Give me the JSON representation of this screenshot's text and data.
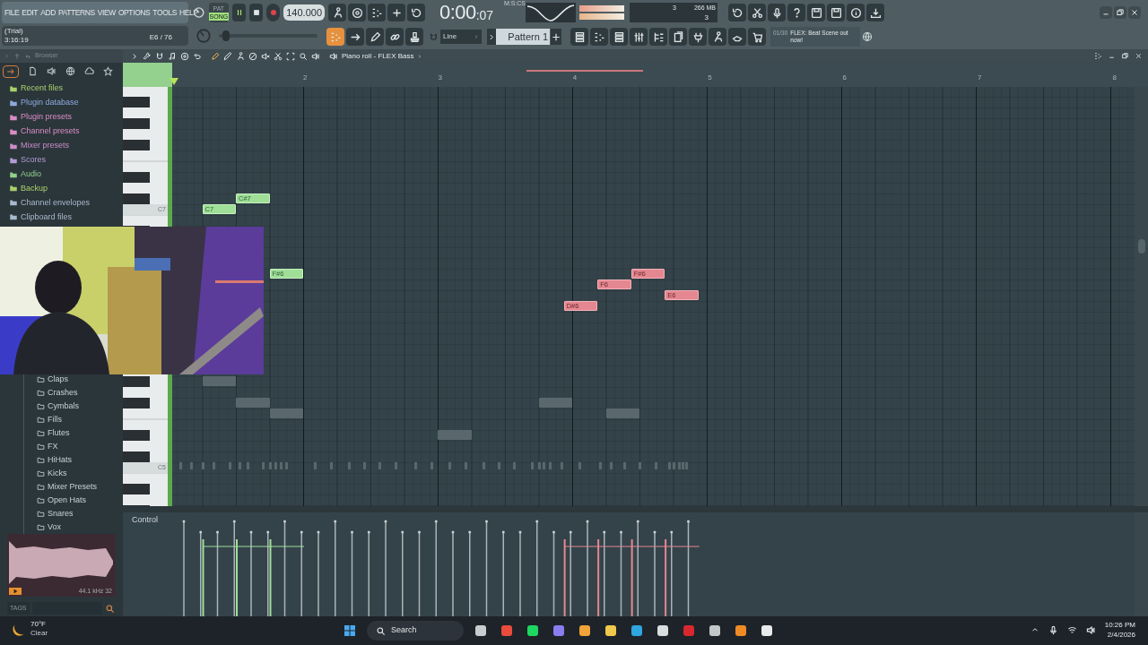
{
  "menu": [
    "FILE",
    "EDIT",
    "ADD",
    "PATTERNS",
    "VIEW",
    "OPTIONS",
    "TOOLS",
    "HELP"
  ],
  "hint_panel": {
    "line1": "(Trial)",
    "line2": "3:16:19",
    "note": "E6 / 76"
  },
  "transport": {
    "pattern_label": "PAT",
    "song_label": "SONG",
    "song_selected": true,
    "playing": true,
    "tempo": "140.000"
  },
  "master_pitch": {
    "level": 0.04
  },
  "clock": {
    "unit": "M:S:CS",
    "time": "0:00",
    "centiseconds": ":07"
  },
  "cpu": {
    "value": "3",
    "memory": "266 MB",
    "polyphony": "3"
  },
  "snap": "Line",
  "pattern": "Pattern 1",
  "news": {
    "counter": "01/30",
    "text": "FLEX: Beat Scene out now!"
  },
  "browser": {
    "title": "Browser",
    "items": [
      {
        "label": "Recent files",
        "color": "#a9cf6a"
      },
      {
        "label": "Plugin database",
        "color": "#8ea8dc"
      },
      {
        "label": "Plugin presets",
        "color": "#d98cc4"
      },
      {
        "label": "Channel presets",
        "color": "#d98cc4"
      },
      {
        "label": "Mixer presets",
        "color": "#c98cc8"
      },
      {
        "label": "Scores",
        "color": "#b29ad2"
      },
      {
        "label": "Audio",
        "color": "#8fd08a"
      },
      {
        "label": "Backup",
        "color": "#a9cf6a"
      },
      {
        "label": "Channel envelopes",
        "color": "#a9b9cc"
      },
      {
        "label": "Clipboard files",
        "color": "#a9b9cc"
      }
    ],
    "folders": [
      "Claps",
      "Crashes",
      "Cymbals",
      "Fills",
      "Flutes",
      "FX",
      "HiHats",
      "Kicks",
      "Mixer Presets",
      "Open Hats",
      "Snares",
      "Vox"
    ],
    "sample_info": "44.1 kHz 32",
    "tags": "TAGS"
  },
  "piano_roll": {
    "title": "Piano roll - FLEX Bass",
    "bars": [
      "2",
      "3",
      "4",
      "5",
      "6",
      "7",
      "8"
    ],
    "key_labels": [
      "C7",
      "C5"
    ],
    "notes": [
      {
        "kind": "green",
        "label": "C7"
      },
      {
        "kind": "green",
        "label": "C#7"
      },
      {
        "kind": "green",
        "label": "F#6"
      },
      {
        "kind": "ghost"
      },
      {
        "kind": "ghost"
      },
      {
        "kind": "ghost"
      },
      {
        "kind": "ghost"
      },
      {
        "kind": "ghost"
      },
      {
        "kind": "ghost"
      },
      {
        "kind": "red",
        "label": "D#6"
      },
      {
        "kind": "red",
        "label": "F6"
      },
      {
        "kind": "red",
        "label": "F#6"
      },
      {
        "kind": "red",
        "label": "E6"
      }
    ],
    "control_label": "Control"
  },
  "taskbar": {
    "temperature": "70°F",
    "condition": "Clear",
    "search": "Search",
    "time": "10:26 PM",
    "date": "2/4/2026"
  }
}
